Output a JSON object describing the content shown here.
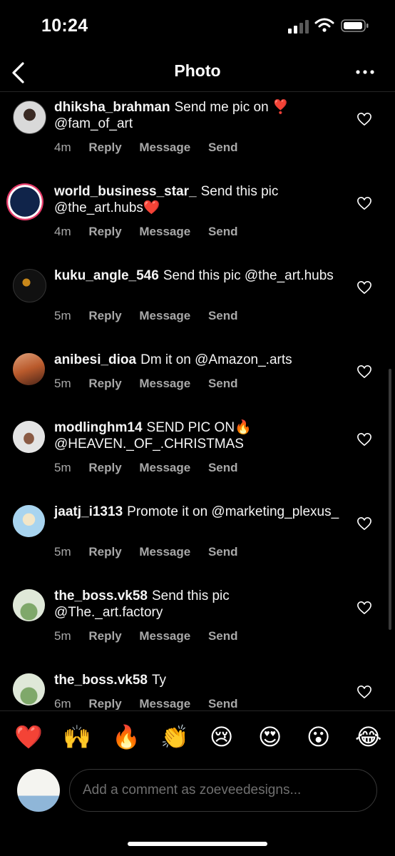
{
  "status": {
    "time": "10:24"
  },
  "header": {
    "title": "Photo"
  },
  "comments": [
    {
      "username": "dhiksha_brahman",
      "text": "Send me pic on ❣️ @fam_of_art",
      "time": "4m"
    },
    {
      "username": "world_business_star_",
      "text": "Send this pic @the_art.hubs❤️",
      "time": "4m"
    },
    {
      "username": "kuku_angle_546",
      "text": "Send this pic @the_art.hubs",
      "time": "5m"
    },
    {
      "username": "anibesi_dioa",
      "text": "Dm it on @Amazon_.arts",
      "time": "5m"
    },
    {
      "username": "modlinghm14",
      "text": "SEND PIC ON🔥 @HEAVEN._OF_.CHRISTMAS",
      "time": "5m"
    },
    {
      "username": "jaatj_i1313",
      "text": "Promote it on @marketing_plexus_",
      "time": "5m"
    },
    {
      "username": "the_boss.vk58",
      "text": "Send this pic @The._art.factory",
      "time": "5m"
    },
    {
      "username": "the_boss.vk58",
      "text": "Ty",
      "time": "6m"
    }
  ],
  "actions": {
    "reply": "Reply",
    "message": "Message",
    "send": "Send"
  },
  "reactions": [
    "❤️",
    "🙌",
    "🔥",
    "👏",
    "😢",
    "😍",
    "😮",
    "😂"
  ],
  "composer": {
    "placeholder": "Add a comment as zoeveedesigns..."
  },
  "colors": {
    "background": "#000000",
    "text": "#ffffff",
    "secondary": "#a8a8a8",
    "heart": "#ed4956"
  },
  "icons": {
    "back": "chevron-left-icon",
    "more": "more-horizontal-icon",
    "like": "heart-outline-icon",
    "signal": "cellular-signal-icon",
    "wifi": "wifi-icon",
    "battery": "battery-icon"
  }
}
